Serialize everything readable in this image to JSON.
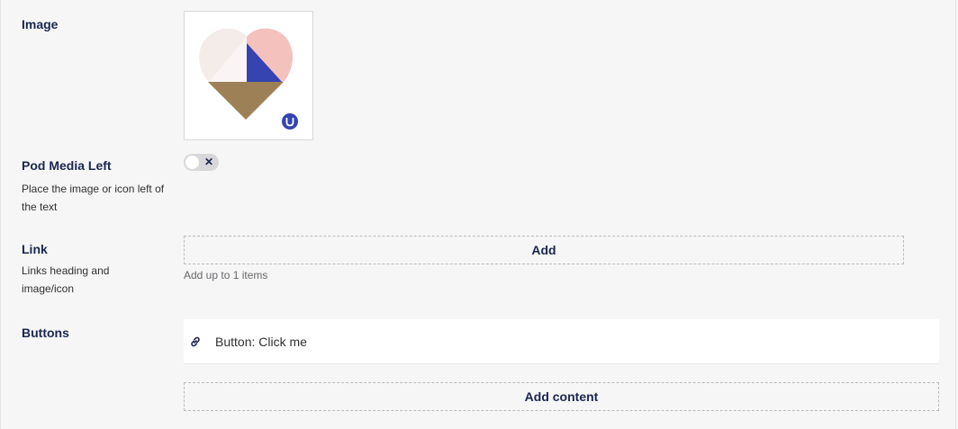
{
  "image_field": {
    "label": "Image"
  },
  "pod_media_left": {
    "label": "Pod Media Left",
    "description": "Place the image or icon left of the text",
    "toggle_symbol": "✕",
    "toggle_on": false
  },
  "link_field": {
    "label": "Link",
    "description": "Links heading and image/icon",
    "add_label": "Add",
    "hint": "Add up to 1 items"
  },
  "buttons_field": {
    "label": "Buttons",
    "items": [
      {
        "text": "Button: Click me",
        "icon": "link-icon"
      }
    ],
    "add_content_label": "Add content"
  },
  "colors": {
    "navy": "#1b264f",
    "heart_blue": "#3544b1",
    "heart_pink": "#f5c1bc",
    "heart_cream": "#f3ece8",
    "heart_brown": "#9d8055"
  }
}
